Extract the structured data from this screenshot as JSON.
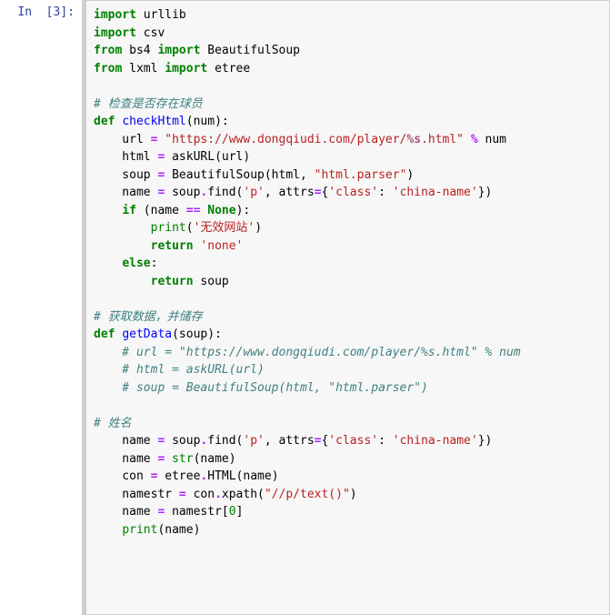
{
  "prompt": "In  [3]:",
  "lines": {
    "l1a": "import",
    "l1b": " urllib",
    "l2a": "import",
    "l2b": " csv",
    "l3a": "from",
    "l3b": " bs4 ",
    "l3c": "import",
    "l3d": " BeautifulSoup",
    "l4a": "from",
    "l4b": " lxml ",
    "l4c": "import",
    "l4d": " etree",
    "blank": "",
    "c1": "# 检查是否存在球员",
    "d1a": "def",
    "d1b": " ",
    "d1c": "checkHtml",
    "d1d": "(num):",
    "u1a": "    url ",
    "u1b": "=",
    "u1c": " ",
    "u1d": "\"https://www.dongqiudi.com/player/",
    "u1e": "%s",
    "u1f": ".html\"",
    "u1g": " ",
    "u1h": "%",
    "u1i": " num",
    "h1a": "    html ",
    "h1b": "=",
    "h1c": " askURL(url)",
    "s1a": "    soup ",
    "s1b": "=",
    "s1c": " BeautifulSoup(html, ",
    "s1d": "\"html.parser\"",
    "s1e": ")",
    "n1a": "    name ",
    "n1b": "=",
    "n1c": " soup",
    "n1d": ".",
    "n1e": "find(",
    "n1f": "'p'",
    "n1g": ", attrs",
    "n1h": "=",
    "n1i": "{",
    "n1j": "'class'",
    "n1k": ": ",
    "n1l": "'china-name'",
    "n1m": "})",
    "if1a": "    ",
    "if1b": "if",
    "if1c": " (name ",
    "if1d": "==",
    "if1e": " ",
    "if1f": "None",
    "if1g": "):",
    "p1a": "        ",
    "p1b": "print",
    "p1c": "(",
    "p1d": "'无效网站'",
    "p1e": ")",
    "r1a": "        ",
    "r1b": "return",
    "r1c": " ",
    "r1d": "'none'",
    "e1a": "    ",
    "e1b": "else",
    "e1c": ":",
    "r2a": "        ",
    "r2b": "return",
    "r2c": " soup",
    "c2": "# 获取数据，并储存",
    "d2a": "def",
    "d2b": " ",
    "d2c": "getData",
    "d2d": "(soup):",
    "cc1": "    # url = \"https://www.dongqiudi.com/player/%s.html\" % num",
    "cc2": "    # html = askURL(url)",
    "cc3": "    # soup = BeautifulSoup(html, \"html.parser\")",
    "c3": "# 姓名",
    "n2a": "    name ",
    "n2b": "=",
    "n2c": " soup",
    "n2d": ".",
    "n2e": "find(",
    "n2f": "'p'",
    "n2g": ", attrs",
    "n2h": "=",
    "n2i": "{",
    "n2j": "'class'",
    "n2k": ": ",
    "n2l": "'china-name'",
    "n2m": "})",
    "n3a": "    name ",
    "n3b": "=",
    "n3c": " ",
    "n3d": "str",
    "n3e": "(name)",
    "co1a": "    con ",
    "co1b": "=",
    "co1c": " etree",
    "co1d": ".",
    "co1e": "HTML(name)",
    "ns1a": "    namestr ",
    "ns1b": "=",
    "ns1c": " con",
    "ns1d": ".",
    "ns1e": "xpath(",
    "ns1f": "\"//p/text()\"",
    "ns1g": ")",
    "n4a": "    name ",
    "n4b": "=",
    "n4c": " namestr[",
    "n4d": "0",
    "n4e": "]",
    "pr1a": "    ",
    "pr1b": "print",
    "pr1c": "(name)"
  }
}
